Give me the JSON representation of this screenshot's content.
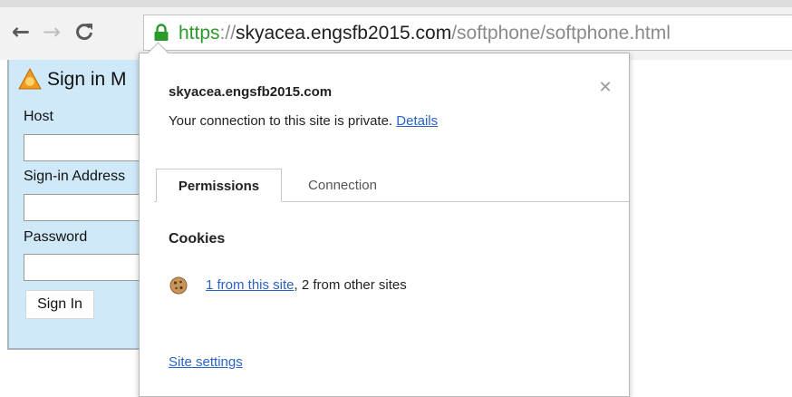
{
  "toolbar": {
    "back_icon": "back-arrow-icon",
    "forward_icon": "forward-arrow-icon",
    "reload_icon": "reload-icon"
  },
  "address_bar": {
    "scheme": "https",
    "separator": "://",
    "host": "skyacea.engsfb2015.com",
    "path": "/softphone/softphone.html",
    "secure_icon": "lock-icon",
    "secure_color": "#2b9a2b"
  },
  "page": {
    "title": "Sign in M",
    "host_label": "Host",
    "signin_address_label": "Sign-in Address",
    "password_label": "Password",
    "signin_button": "Sign In",
    "host_value": "",
    "signin_address_value": "",
    "password_value": ""
  },
  "site_info": {
    "site": "skyacea.engsfb2015.com",
    "close_icon": "close-icon",
    "connection_text": "Your connection to this site is private.",
    "details_link": "Details",
    "tabs": [
      {
        "label": "Permissions",
        "active": true
      },
      {
        "label": "Connection",
        "active": false
      }
    ],
    "cookies_heading": "Cookies",
    "cookies_link": "1 from this site",
    "cookies_comma": ",",
    "cookies_rest": " 2 from other sites",
    "site_settings_link": "Site settings",
    "link_color": "#2a62c8"
  }
}
